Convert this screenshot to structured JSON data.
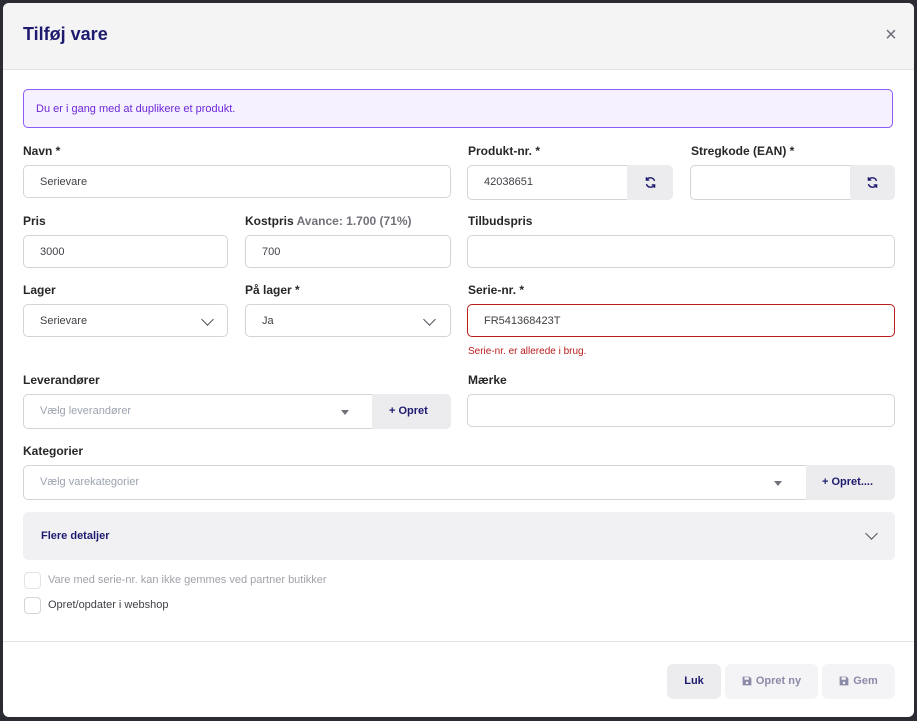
{
  "modal": {
    "title": "Tilføj vare",
    "close": "×"
  },
  "banner": {
    "text": "Du er i gang med at duplikere et produkt."
  },
  "fields": {
    "navn": {
      "label": "Navn *",
      "value": "Serievare"
    },
    "produktnr": {
      "label": "Produkt-nr. *",
      "value": "42038651"
    },
    "stregkode": {
      "label": "Stregkode (EAN) *",
      "value": ""
    },
    "pris": {
      "label": "Pris",
      "value": "3000"
    },
    "kostpris": {
      "label": "Kostpris",
      "sub": "Avance: 1.700 (71%)",
      "value": "700"
    },
    "tilbudspris": {
      "label": "Tilbudspris",
      "value": ""
    },
    "lager": {
      "label": "Lager",
      "value": "Serievare"
    },
    "paa_lager": {
      "label": "På lager *",
      "value": "Ja"
    },
    "serienr": {
      "label": "Serie-nr. *",
      "value": "FR541368423T",
      "error": "Serie-nr. er allerede i brug."
    },
    "leverandorer": {
      "label": "Leverandører",
      "placeholder": "Vælg leverandører",
      "add": "+ Opret"
    },
    "maerke": {
      "label": "Mærke",
      "value": ""
    },
    "kategorier": {
      "label": "Kategorier",
      "placeholder": "Vælg varekategorier",
      "add": "+ Opret...."
    }
  },
  "accordion": {
    "label": "Flere detaljer"
  },
  "checkboxes": [
    {
      "label": "Vare med serie-nr. kan ikke gemmes ved partner butikker",
      "disabled": true
    },
    {
      "label": "Opret/opdater i webshop",
      "disabled": false
    }
  ],
  "footer": {
    "close": "Luk",
    "create_new": "Opret ny",
    "save": "Gem"
  },
  "colors": {
    "accent": "#1e1b6e",
    "error": "#b91c1c",
    "banner": "#8b5cf6"
  }
}
